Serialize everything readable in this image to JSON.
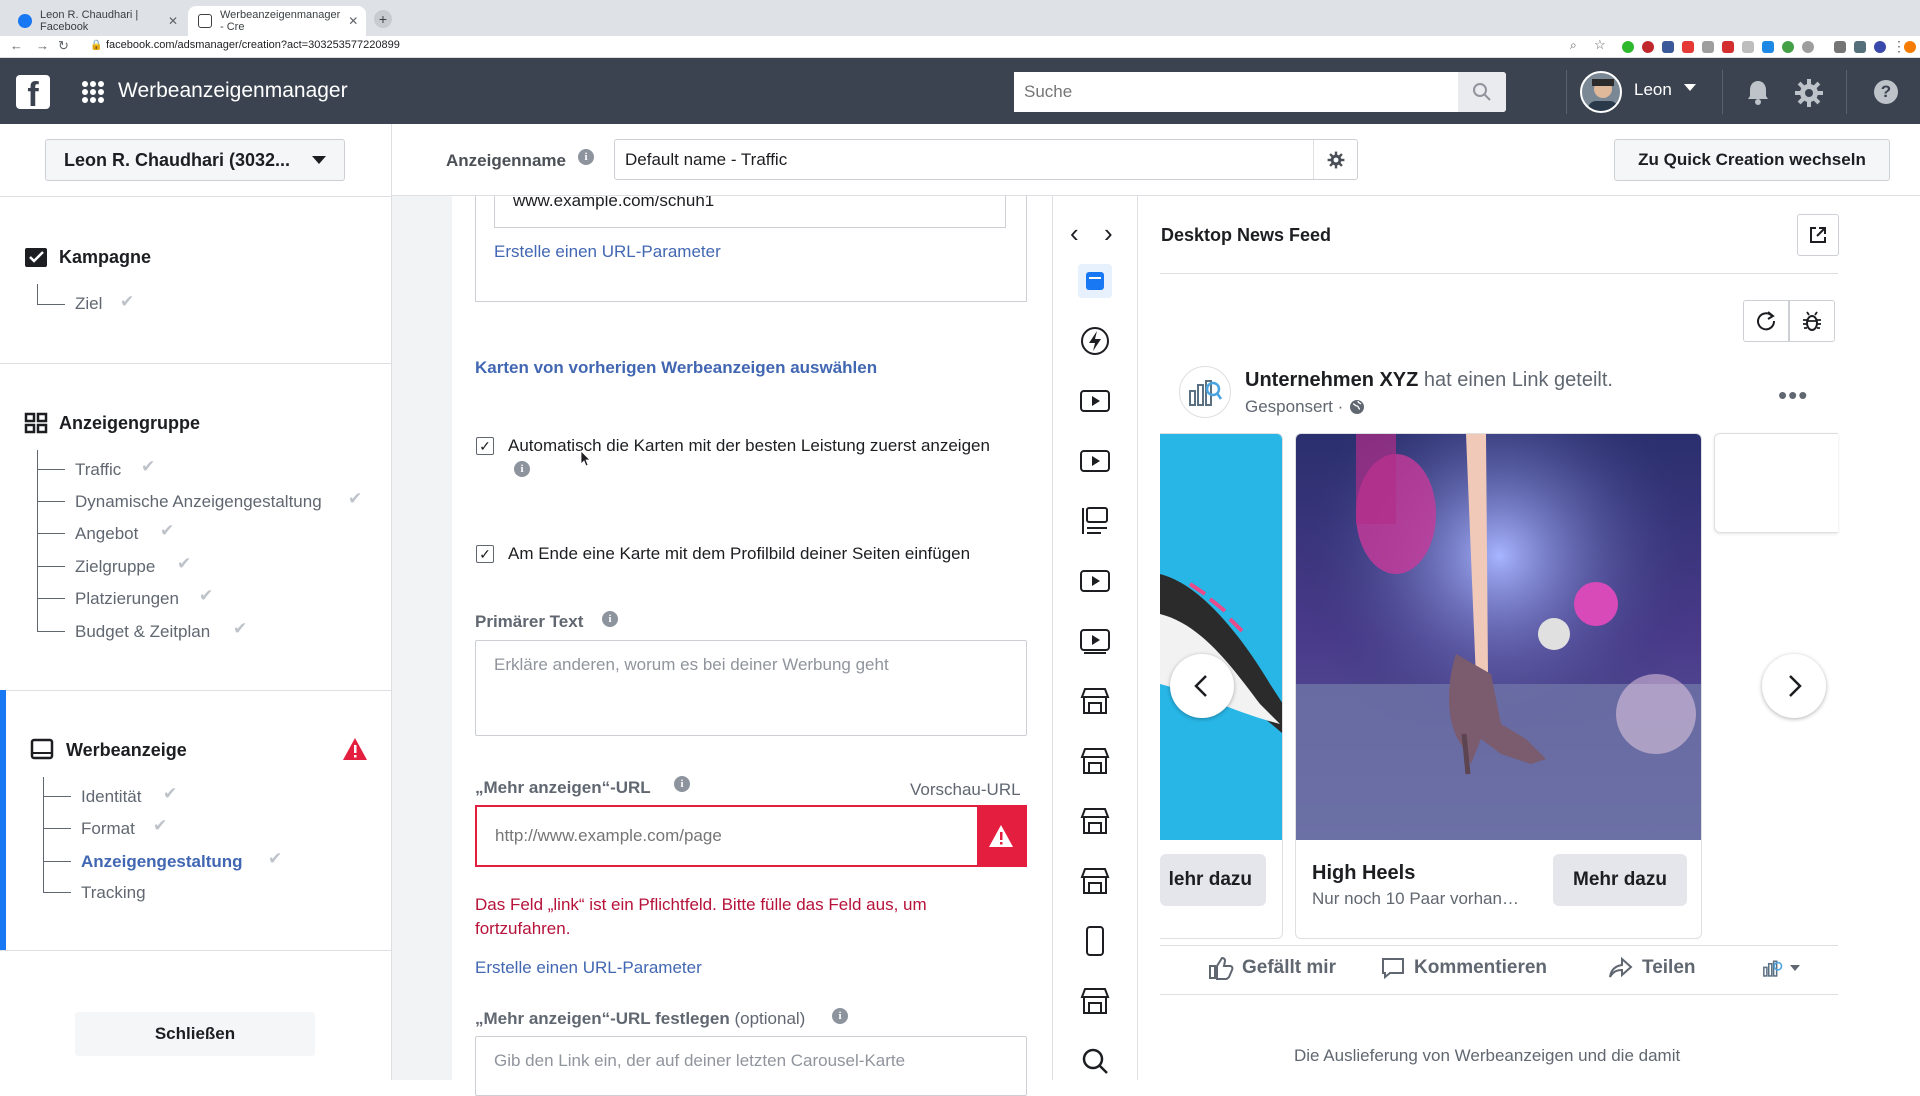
{
  "browser": {
    "tabs": [
      {
        "title": "Leon R. Chaudhari | Facebook"
      },
      {
        "title": "Werbeanzeigenmanager - Cre"
      }
    ],
    "url": "facebook.com/adsmanager/creation?act=303253577220899"
  },
  "topbar": {
    "app_title": "Werbeanzeigenmanager",
    "search_placeholder": "Suche",
    "user_name": "Leon"
  },
  "sidebar": {
    "account": "Leon R. Chaudhari (3032...",
    "campaign": {
      "title": "Kampagne",
      "items": [
        "Ziel"
      ]
    },
    "adset": {
      "title": "Anzeigengruppe",
      "items": [
        "Traffic",
        "Dynamische Anzeigengestaltung",
        "Angebot",
        "Zielgruppe",
        "Platzierungen",
        "Budget & Zeitplan"
      ]
    },
    "ad": {
      "title": "Werbeanzeige",
      "items": [
        "Identität",
        "Format",
        "Anzeigengestaltung",
        "Tracking"
      ]
    },
    "close_label": "Schließen"
  },
  "header": {
    "ad_name_label": "Anzeigenname",
    "ad_name_value": "Default name - Traffic",
    "quick_creation": "Zu Quick Creation wechseln"
  },
  "editor": {
    "url_value": "www.example.com/schuh1",
    "create_param_1": "Erstelle einen URL-Parameter",
    "select_cards": "Karten von vorherigen Werbeanzeigen auswählen",
    "checkbox_auto": "Automatisch die Karten mit der besten Leistung zuerst anzeigen",
    "checkbox_end": "Am Ende eine Karte mit dem Profilbild deiner Seiten einfügen",
    "primary_text_label": "Primärer Text",
    "primary_text_placeholder": "Erkläre anderen, worum es bei deiner Werbung geht",
    "more_url_label": "„Mehr anzeigen“-URL",
    "preview_url": "Vorschau-URL",
    "more_url_placeholder": "http://www.example.com/page",
    "error": "Das Feld „link“ ist ein Pflichtfeld. Bitte fülle das Feld aus, um fortzufahren.",
    "create_param_2": "Erstelle einen URL-Parameter",
    "set_url_label": "„Mehr anzeigen“-URL festlegen",
    "optional": "(optional)",
    "set_url_placeholder": "Gib den Link ein, der auf deiner letzten Carousel-Karte"
  },
  "preview": {
    "title": "Desktop News Feed",
    "page_name": "Unternehmen XYZ",
    "shared_text": "hat einen Link geteilt.",
    "sponsored": "Gesponsert ·",
    "card_left_cta": "lehr dazu",
    "card_title": "High Heels",
    "card_desc": "Nur noch 10 Paar vorhan…",
    "card_cta": "Mehr dazu",
    "like": "Gefällt mir",
    "comment": "Kommentieren",
    "share": "Teilen",
    "footer": "Die Auslieferung von Werbeanzeigen und die damit"
  },
  "colors": {
    "fb_bar": "#3b4350",
    "link": "#4267b2",
    "error": "#e41e3f",
    "active": "#1877f2"
  }
}
